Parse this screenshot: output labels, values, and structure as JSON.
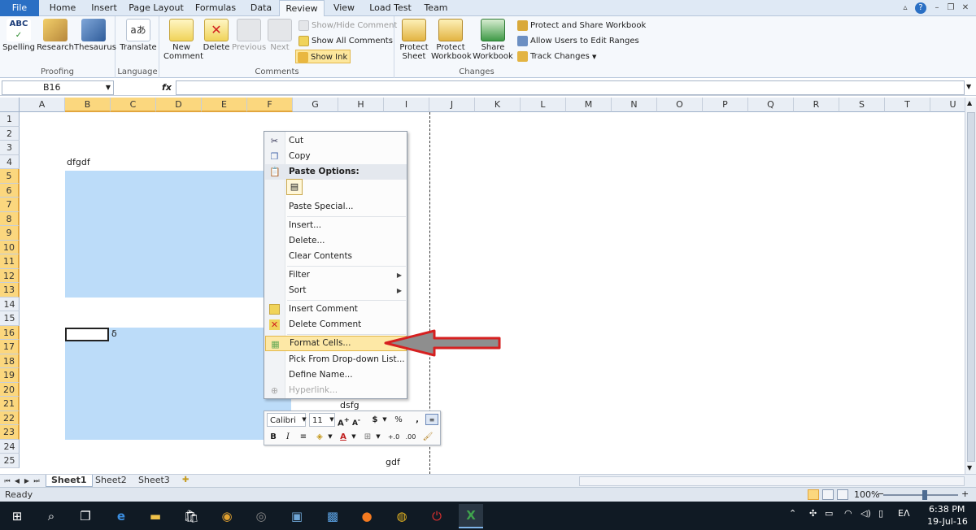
{
  "ribbon_tabs": [
    "File",
    "Home",
    "Insert",
    "Page Layout",
    "Formulas",
    "Data",
    "Review",
    "View",
    "Load Test",
    "Team"
  ],
  "active_tab": "Review",
  "ribbon": {
    "proofing": {
      "label": "Proofing",
      "spelling": "Spelling",
      "research": "Research",
      "thesaurus": "Thesaurus"
    },
    "language": {
      "label": "Language",
      "translate": "Translate"
    },
    "comments": {
      "label": "Comments",
      "new_comment_1": "New",
      "new_comment_2": "Comment",
      "delete": "Delete",
      "previous": "Previous",
      "next": "Next",
      "show_hide": "Show/Hide Comment",
      "show_all": "Show All Comments",
      "show_ink": "Show Ink"
    },
    "changes": {
      "label": "Changes",
      "protect_sheet_1": "Protect",
      "protect_sheet_2": "Sheet",
      "protect_workbook_1": "Protect",
      "protect_workbook_2": "Workbook",
      "share_workbook_1": "Share",
      "share_workbook_2": "Workbook",
      "protect_share": "Protect and Share Workbook",
      "allow_users": "Allow Users to Edit Ranges",
      "track_changes": "Track Changes"
    }
  },
  "formula_bar": {
    "name_box": "B16",
    "fx": "fx",
    "formula": ""
  },
  "columns": [
    "A",
    "B",
    "C",
    "D",
    "E",
    "F",
    "G",
    "H",
    "I",
    "J",
    "K",
    "L",
    "M",
    "N",
    "O",
    "P",
    "Q",
    "R",
    "S",
    "T",
    "U"
  ],
  "rows": [
    "1",
    "2",
    "3",
    "4",
    "5",
    "6",
    "7",
    "8",
    "9",
    "10",
    "11",
    "12",
    "13",
    "14",
    "15",
    "16",
    "17",
    "18",
    "19",
    "20",
    "21",
    "22",
    "23",
    "24",
    "25"
  ],
  "cells": {
    "b4": "dfgdf",
    "c16": "δ",
    "h21": "dsfg",
    "i25": "gdf"
  },
  "context_menu": {
    "cut": "Cut",
    "copy": "Copy",
    "paste_options": "Paste Options:",
    "paste_special": "Paste Special...",
    "insert": "Insert...",
    "delete": "Delete...",
    "clear_contents": "Clear Contents",
    "filter": "Filter",
    "sort": "Sort",
    "insert_comment": "Insert Comment",
    "delete_comment": "Delete Comment",
    "format_cells": "Format Cells...",
    "pick_from_list": "Pick From Drop-down List...",
    "define_name": "Define Name...",
    "hyperlink": "Hyperlink..."
  },
  "mini_toolbar": {
    "font": "Calibri",
    "size": "11",
    "currency": "$",
    "percent": "%",
    "comma": ",",
    "bold": "B",
    "italic": "I"
  },
  "sheets": [
    "Sheet1",
    "Sheet2",
    "Sheet3"
  ],
  "active_sheet": "Sheet1",
  "status": {
    "ready": "Ready",
    "zoom": "100%"
  },
  "taskbar": {
    "time": "6:38 PM",
    "date": "19-Jul-16",
    "lang": "EΛ"
  },
  "colors": {
    "selection": "#bcdcf9",
    "highlight": "#fde8a6",
    "file_tab": "#2a6fc4",
    "arrow": "#d62020"
  }
}
